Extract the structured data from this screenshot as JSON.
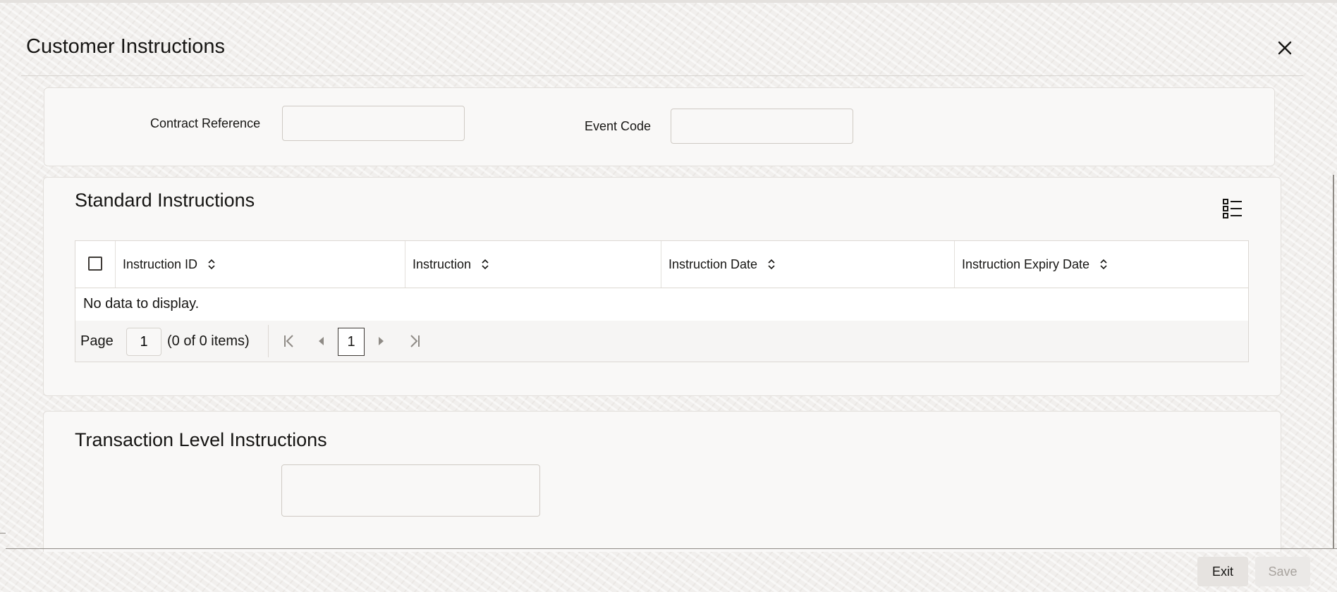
{
  "window": {
    "title": "Customer Instructions",
    "close_icon": "close-icon"
  },
  "header_panel": {
    "contract_reference_label": "Contract Reference",
    "contract_reference_value": "",
    "event_code_label": "Event Code",
    "event_code_value": ""
  },
  "standard_instructions": {
    "title": "Standard Instructions",
    "columns": [
      "Instruction ID",
      "Instruction",
      "Instruction Date",
      "Instruction Expiry Date"
    ],
    "empty_text": "No data to display.",
    "pager": {
      "page_label": "Page",
      "page_value": "1",
      "items_text": "(0 of 0 items)",
      "current_page": "1"
    }
  },
  "transaction_level": {
    "title": "Transaction Level Instructions",
    "value": ""
  },
  "footer": {
    "exit_label": "Exit",
    "save_label": "Save"
  },
  "colors": {
    "text": "#161513",
    "panel": "#f9f8f7",
    "disabled_text": "#a8a39e"
  }
}
